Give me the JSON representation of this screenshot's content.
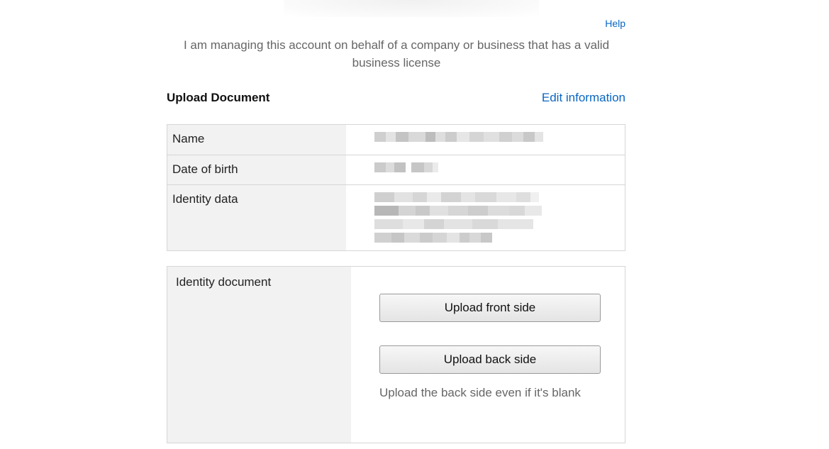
{
  "header": {
    "help_label": "Help",
    "intro_text": "I am managing this account on behalf of a company or business that has a valid business license"
  },
  "upload_section": {
    "title": "Upload Document",
    "edit_label": "Edit information"
  },
  "info_table": {
    "rows": [
      {
        "label": "Name"
      },
      {
        "label": "Date of birth"
      },
      {
        "label": "Identity data"
      }
    ]
  },
  "identity_document": {
    "label": "Identity document",
    "upload_front_label": "Upload front side",
    "upload_back_label": "Upload back side",
    "hint": "Upload the back side even if it's blank"
  },
  "colors": {
    "link": "#0a66c2",
    "label_bg": "#f2f2f2",
    "border": "#d6d6d6",
    "muted_text": "#666666"
  }
}
